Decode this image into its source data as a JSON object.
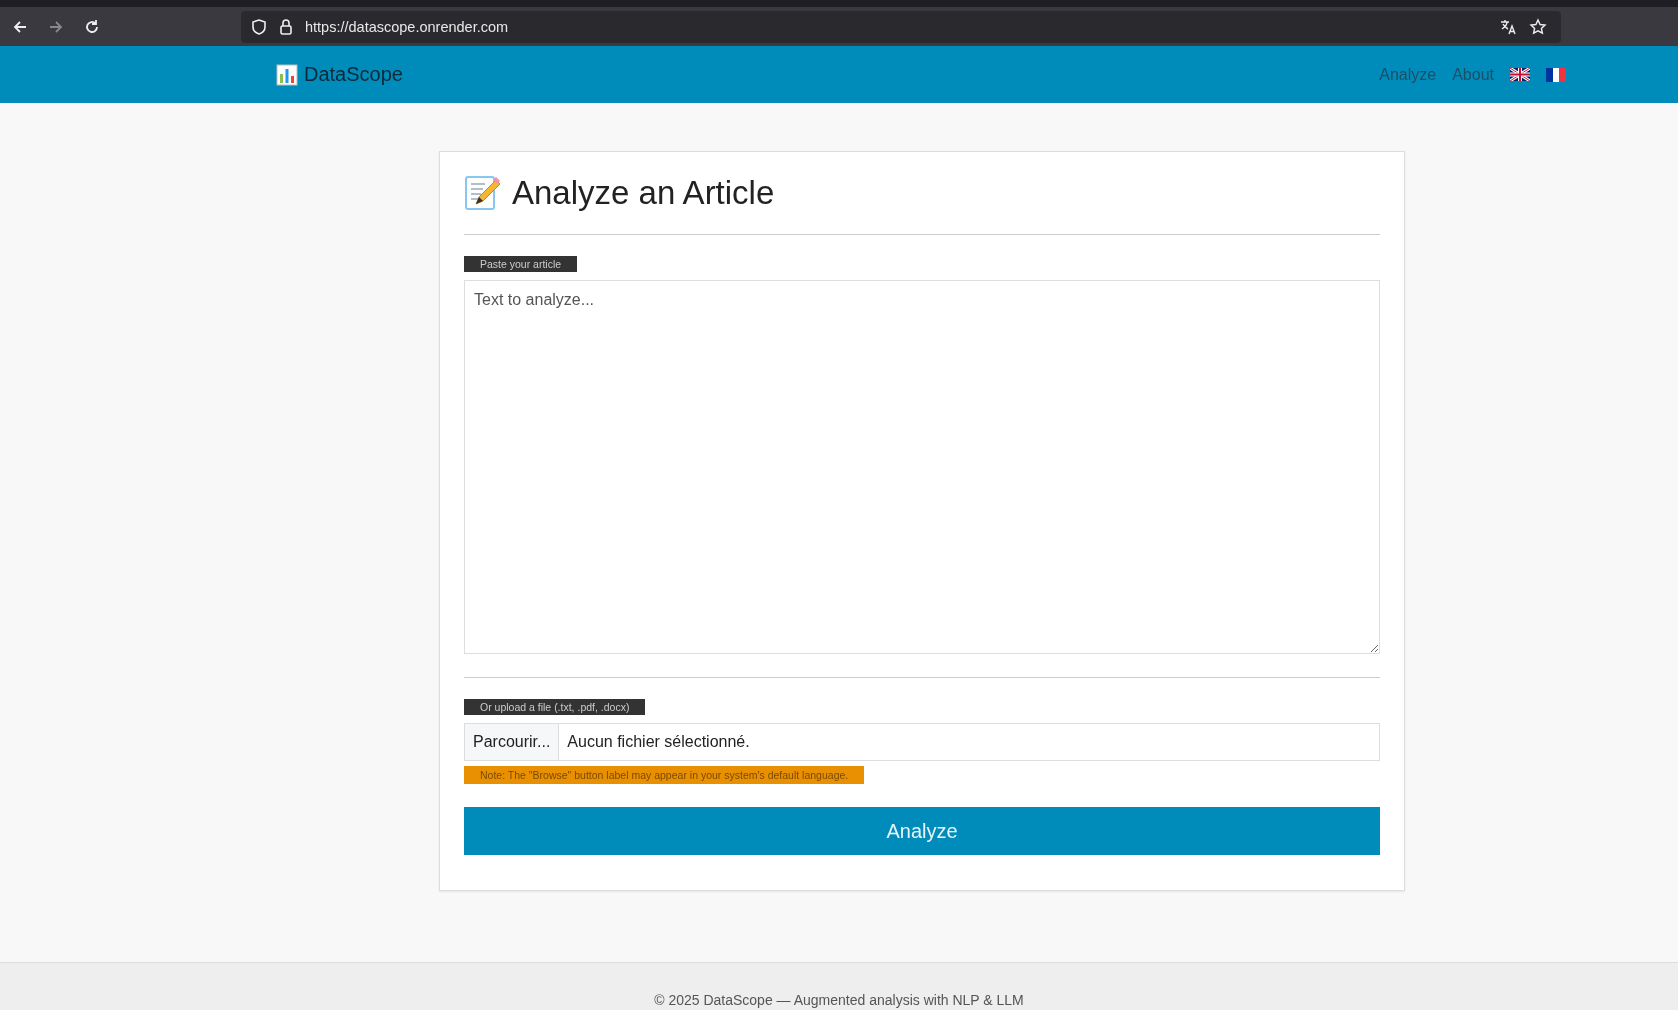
{
  "browser": {
    "url": "https://datascope.onrender.com"
  },
  "navbar": {
    "brand": "DataScope",
    "links": [
      {
        "label": "Analyze"
      },
      {
        "label": "About"
      }
    ]
  },
  "card": {
    "title": "Analyze an Article",
    "text_label": "Paste your article",
    "text_field": {
      "placeholder": "Text to analyze..."
    },
    "file_label": "Or upload a file (.txt, .pdf, .docx)",
    "file_button": "Parcourir...",
    "file_status": "Aucun fichier sélectionné.",
    "note": "Note: The \"Browse\" button label may appear in your system's default language.",
    "submit": "Analyze"
  },
  "footer": {
    "text": "© 2025 DataScope — Augmented analysis with NLP & LLM"
  }
}
